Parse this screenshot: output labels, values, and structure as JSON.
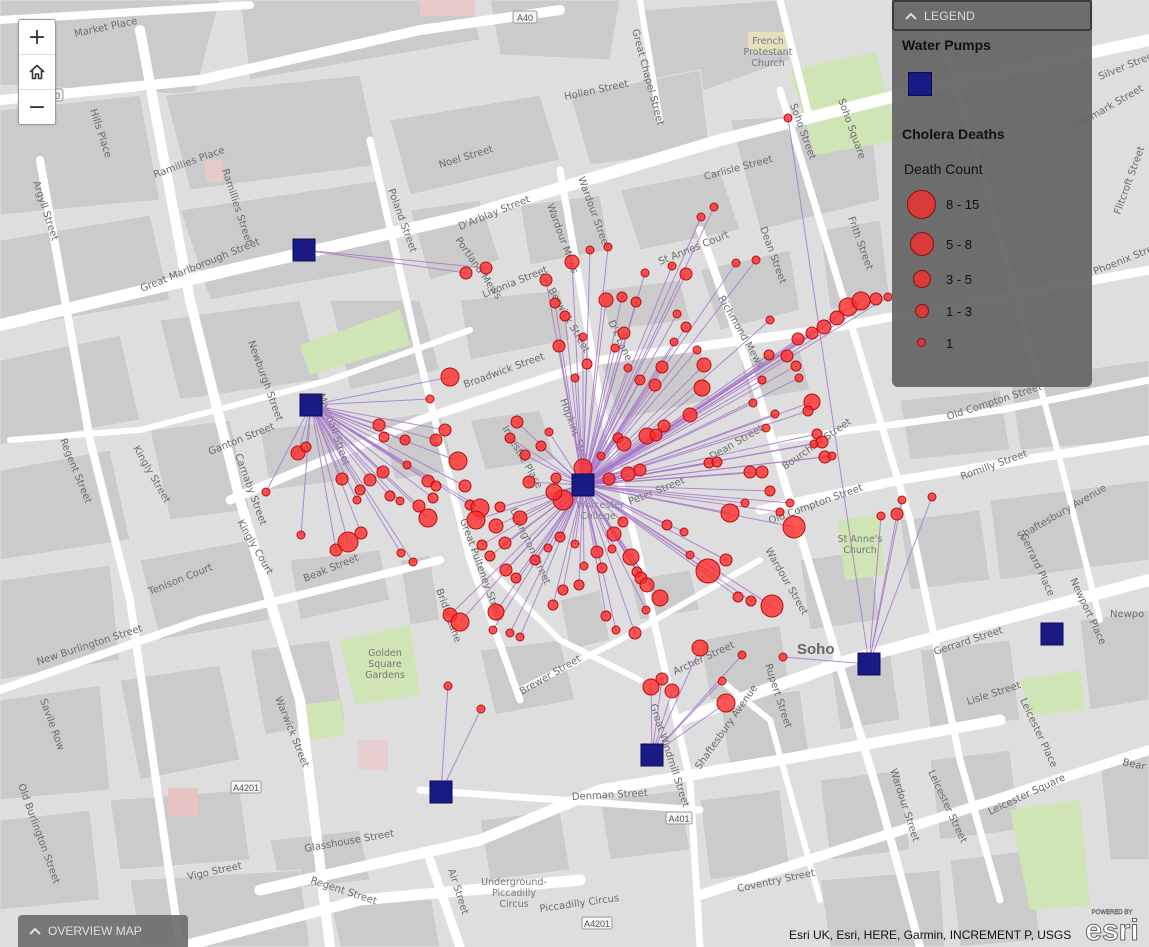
{
  "legend": {
    "header": "LEGEND",
    "pumps_title": "Water Pumps",
    "deaths_title": "Cholera Deaths",
    "death_count_label": "Death Count",
    "classes": [
      "8 - 15",
      "5 - 8",
      "3 - 5",
      "1 - 3",
      "1"
    ]
  },
  "overview": {
    "label": "OVERVIEW MAP"
  },
  "attribution": "Esri UK, Esri, HERE, Garmin, INCREMENT P, USGS",
  "esri_logo": {
    "top": "POWERED BY",
    "word": "esri"
  },
  "colors": {
    "pump": "#1a1a85",
    "death_fill": "#ff2b2b",
    "death_stroke": "#b31010",
    "link_line": "#a779c9",
    "park": "#cfe8b8",
    "building": "#c8c8c8",
    "road": "#ffffff"
  },
  "zoom": {
    "in": "+",
    "home": "home-icon",
    "out": "−"
  },
  "map": {
    "streets": {
      "market_place": "Market Place",
      "noel_street": "Noel Street",
      "hollen_street": "Hollen Street",
      "great_chapel_street": "Great Chapel Street",
      "soho_street": "Soho Street",
      "soho_square": "Soho Square",
      "carlisle_street": "Carlisle Street",
      "darblay_street": "D'Arblay Street",
      "wardour_mews": "Wardour Mews",
      "wardour_street_n": "Wardour Street",
      "st_annes_court": "St Annes Court",
      "dean_street": "Dean Street",
      "frith_street": "Frith Street",
      "great_marlborough_street": "Great Marlborough Street",
      "poland_street": "Poland Street",
      "portland_mews": "Portland Mews",
      "livonia_street": "Livonia Street",
      "berwick_street": "Berwick Street",
      "dufour_lane": "D'k Lane",
      "richmond_mews": "Richmond Mews",
      "broadwick_street": "Broadwick Street",
      "hopkins_street": "Hopkins Street",
      "ingestre_place": "Ingestre Place",
      "marshall_street": "Marshall Street",
      "newburgh_street": "Newburgh Street",
      "ganton_street": "Ganton Street",
      "carnaby_street": "Carnaby Street",
      "kingly_street": "Kingly Street",
      "regent_street_w": "Regent Street",
      "kingly_court": "Kingly Court",
      "beak_street": "Beak Street",
      "great_pulteney_street": "Great Pulteney Street",
      "lexington_street": "Lexington Street",
      "peter_street": "Peter Street",
      "brewer_street": "Brewer Street",
      "bridle_lane": "Bridle Lane",
      "tenison_court": "Tenison Court",
      "new_burlington_street": "New Burlington Street",
      "warwick_street": "Warwick Street",
      "savile_row": "Savile Row",
      "old_burlington_street": "Old Burlington Street",
      "glasshouse_street": "Glasshouse Street",
      "vigo_street": "Vigo Street",
      "regent_street_s": "Regent Street",
      "air_street": "Air Street",
      "denman_street": "Denman Street",
      "great_windmill_street": "Great Windmill Street",
      "archer_street": "Archer Street",
      "rupert_street": "Rupert Street",
      "shaftesbury_avenue_s": "Shaftesbury Avenue",
      "shaftesbury_avenue_e": "Shaftesbury Avenue",
      "wardour_street_s": "Wardour Street",
      "wardour_street_se": "Wardour Street",
      "old_compton_street": "Old Compton Street",
      "old_compton_street_e": "Old Compton Street",
      "romilly_street": "Romilly Street",
      "gerrard_street": "Gerrard Street",
      "gerrard_place": "Gerrard Place",
      "newport_place": "Newport Place",
      "lisle_street": "Lisle Street",
      "leicester_place": "Leicester Place",
      "leicester_street": "Leicester Street",
      "leicester_square": "Leicester Square",
      "coventry_street": "Coventry Street",
      "piccadilly_circus": "Piccadilly Circus",
      "hills_place": "Hills Place",
      "ramillies_place": "Ramillies Place",
      "ramillies_street": "Ramillies Street",
      "argyll_street": "Argyll Street",
      "denmark_street": "Denmark Street",
      "flitcroft_street": "Flitcroft Street",
      "phoenix_street": "Phoenix Street",
      "newport_court": "Newpo",
      "bear_street": "Bear",
      "dean_street_s": "Dean Street",
      "bourchier_street": "Bourchier Street",
      "great_marlborough_e": "Silver Street"
    },
    "places": {
      "french_church": [
        "French",
        "Protestant",
        "Church"
      ],
      "st_annes_church": [
        "St Anne's",
        "Church"
      ],
      "golden_square": [
        "Golden",
        "Square",
        "Gardens"
      ],
      "underground": [
        "Underground-",
        "Piccadilly",
        "Circus"
      ],
      "soho": "Soho",
      "pump_label": [
        "Worcester",
        "College"
      ]
    },
    "shields": [
      "A40",
      "A40",
      "A4201",
      "A401",
      "A4201"
    ]
  }
}
